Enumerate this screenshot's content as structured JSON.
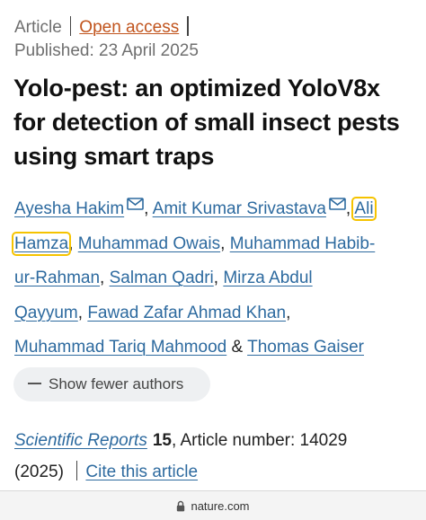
{
  "header": {
    "type_label": "Article",
    "access_label": "Open access",
    "published": "Published: 23 April 2025"
  },
  "title": "Yolo-pest: an optimized YoloV8x for detection of small insect pests using smart traps",
  "authors": [
    "Ayesha Hakim",
    "Amit Kumar Srivastava",
    "Ali",
    "Hamza",
    "Muhammad Owais",
    "Muhammad Habib-",
    "ur-Rahman",
    "Salman Qadri",
    "Mirza Abdul",
    "Qayyum",
    "Fawad Zafar Ahmad Khan",
    "Muhammad Tariq Mahmood",
    "Thomas Gaiser"
  ],
  "author_separators": {
    "comma": ",",
    "and": "&"
  },
  "show_fewer_label": "Show fewer authors",
  "citation": {
    "journal": "Scientific Reports",
    "volume": "15",
    "article_number": ", Article number: 14029",
    "year": "(2025)",
    "cite_label": "Cite this article"
  },
  "browser": {
    "url": "nature.com"
  },
  "colors": {
    "link": "#2d6a9f",
    "access": "#c1541d",
    "highlight": "#f5c300"
  }
}
